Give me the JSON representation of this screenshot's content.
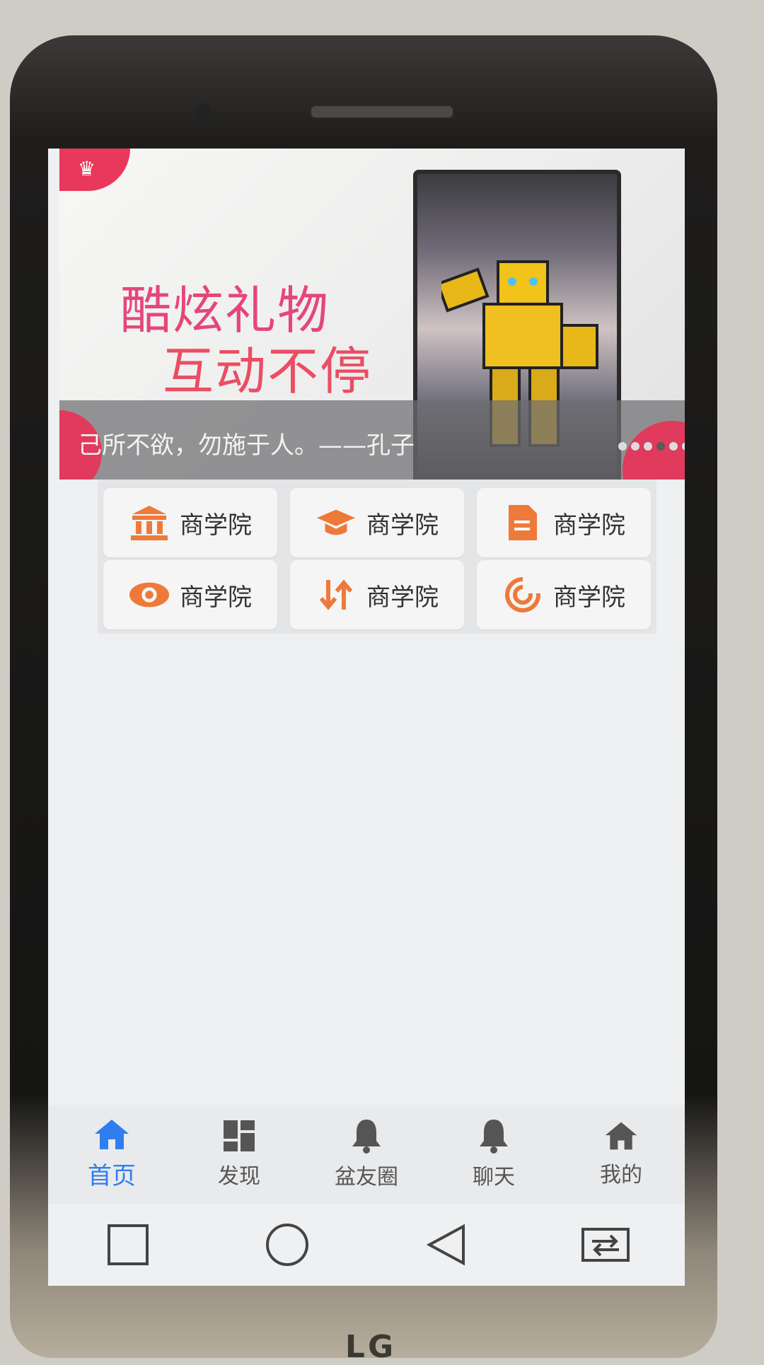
{
  "device": {
    "brand": "LG"
  },
  "banner": {
    "headline_line1": "酷炫礼物",
    "headline_line2": "互动不停",
    "caption": "己所不欲，勿施于人。——孔子",
    "slide_count": 6,
    "active_slide": 4,
    "colors": {
      "accent": "#e03a5d",
      "headline": "#e5467a"
    }
  },
  "grid": {
    "items": [
      {
        "label": "商学院",
        "icon": "bank-icon"
      },
      {
        "label": "商学院",
        "icon": "graduation-cap-icon"
      },
      {
        "label": "商学院",
        "icon": "document-icon"
      },
      {
        "label": "商学院",
        "icon": "eye-icon"
      },
      {
        "label": "商学院",
        "icon": "swap-arrows-icon"
      },
      {
        "label": "商学院",
        "icon": "target-swirl-icon"
      }
    ],
    "icon_color": "#ee7a3a"
  },
  "tabbar": {
    "items": [
      {
        "label": "首页",
        "icon": "home-icon",
        "active": true
      },
      {
        "label": "发现",
        "icon": "dashboard-icon",
        "active": false
      },
      {
        "label": "盆友圈",
        "icon": "bell-icon",
        "active": false
      },
      {
        "label": "聊天",
        "icon": "bell-icon",
        "active": false
      },
      {
        "label": "我的",
        "icon": "home-icon",
        "active": false
      }
    ],
    "active_color": "#2f7ef0",
    "inactive_color": "#555555"
  },
  "system_nav": {
    "buttons": [
      "recents-square-icon",
      "home-circle-icon",
      "back-triangle-icon",
      "dual-window-icon"
    ]
  }
}
